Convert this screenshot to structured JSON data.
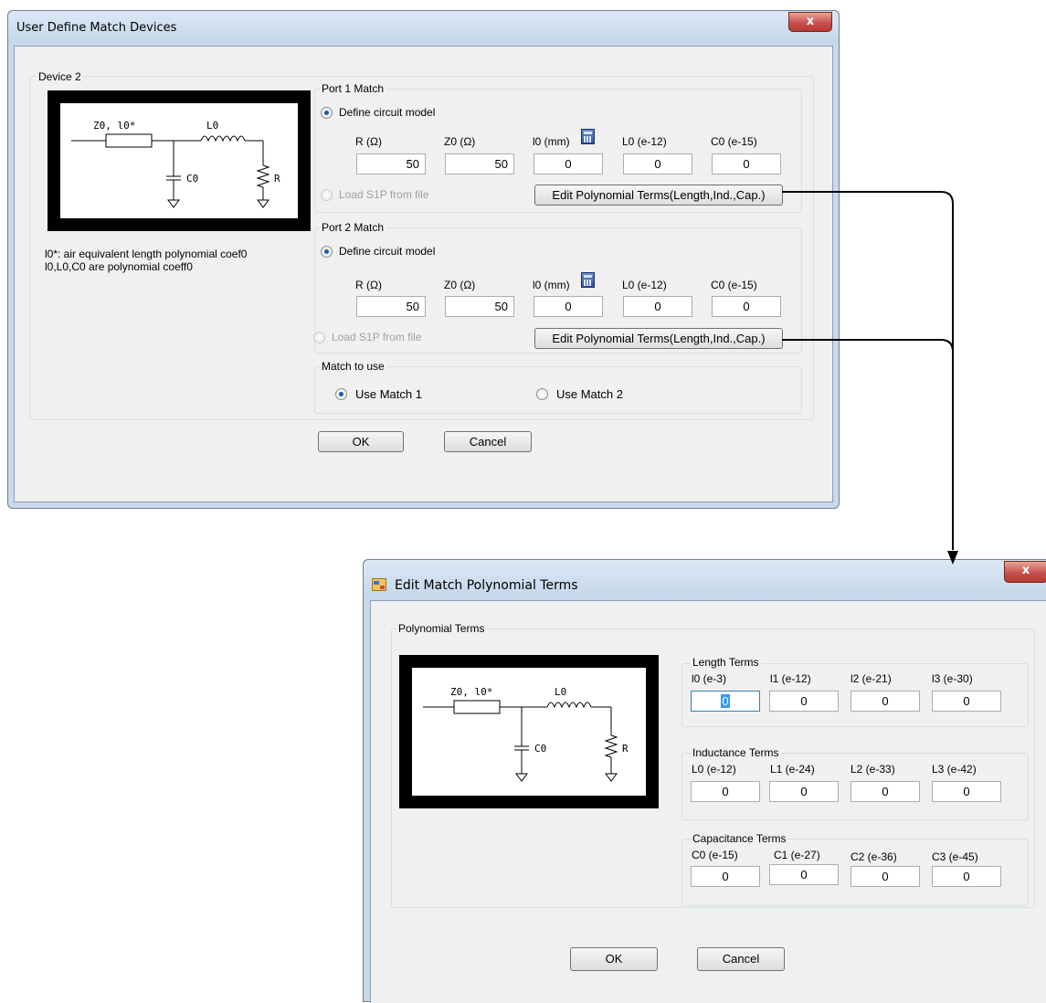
{
  "dialog1": {
    "title": "User Define Match Devices",
    "close": "x",
    "device_group": "Device 2",
    "schematic": {
      "z_label": "Z0, l0*",
      "l_label": "L0",
      "c_label": "C0",
      "r_label": "R"
    },
    "note_line1": "l0*: air equivalent length polynomial coef0",
    "note_line2": "l0,L0,C0 are polynomial coeff0",
    "port1": {
      "title": "Port 1 Match",
      "define_label": "Define circuit model",
      "define_selected": true,
      "fields": [
        {
          "label": "R (Ω)",
          "value": "50"
        },
        {
          "label": "Z0 (Ω)",
          "value": "50"
        },
        {
          "label": "l0 (mm)",
          "value": "0"
        },
        {
          "label": "L0 (e-12)",
          "value": "0"
        },
        {
          "label": "C0 (e-15)",
          "value": "0"
        }
      ],
      "load_label": "Load S1P from file",
      "edit_button": "Edit Polynomial Terms(Length,Ind.,Cap.)"
    },
    "port2": {
      "title": "Port 2 Match",
      "define_label": "Define circuit model",
      "define_selected": true,
      "fields": [
        {
          "label": "R (Ω)",
          "value": "50"
        },
        {
          "label": "Z0 (Ω)",
          "value": "50"
        },
        {
          "label": "l0 (mm)",
          "value": "0"
        },
        {
          "label": "L0 (e-12)",
          "value": "0"
        },
        {
          "label": "C0 (e-15)",
          "value": "0"
        }
      ],
      "load_label": "Load S1P from file",
      "edit_button": "Edit Polynomial Terms(Length,Ind.,Cap.)"
    },
    "match_to_use": {
      "title": "Match to use",
      "option1": "Use Match 1",
      "option2": "Use Match 2",
      "selected": "Use Match 1"
    },
    "ok": "OK",
    "cancel": "Cancel"
  },
  "dialog2": {
    "title": "Edit Match Polynomial Terms",
    "close": "x",
    "group": "Polynomial Terms",
    "schematic": {
      "z_label": "Z0, l0*",
      "l_label": "L0",
      "c_label": "C0",
      "r_label": "R"
    },
    "length": {
      "title": "Length Terms",
      "fields": [
        {
          "label": "l0 (e-3)",
          "value": "0"
        },
        {
          "label": "l1 (e-12)",
          "value": "0"
        },
        {
          "label": "l2 (e-21)",
          "value": "0"
        },
        {
          "label": "l3 (e-30)",
          "value": "0"
        }
      ]
    },
    "inductance": {
      "title": "Inductance Terms",
      "fields": [
        {
          "label": "L0 (e-12)",
          "value": "0"
        },
        {
          "label": "L1 (e-24)",
          "value": "0"
        },
        {
          "label": "L2 (e-33)",
          "value": "0"
        },
        {
          "label": "L3 (e-42)",
          "value": "0"
        }
      ]
    },
    "capacitance": {
      "title": "Capacitance Terms",
      "fields": [
        {
          "label": "C0 (e-15)",
          "value": "0"
        },
        {
          "label": "C1 (e-27)",
          "value": "0"
        },
        {
          "label": "C2 (e-36)",
          "value": "0"
        },
        {
          "label": "C3 (e-45)",
          "value": "0"
        }
      ]
    },
    "ok": "OK",
    "cancel": "Cancel"
  },
  "colors": {
    "arrow": "#000000",
    "accent": "#1f5aa6",
    "close": "#c75050"
  }
}
